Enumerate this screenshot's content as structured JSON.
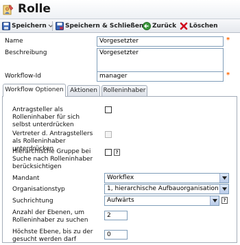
{
  "window": {
    "title": "Rolle"
  },
  "toolbar": {
    "save": "Speichern",
    "save_close": "Speichern & Schließen",
    "back": "Zurück",
    "delete": "Löschen"
  },
  "form": {
    "name_label": "Name",
    "name_value": "Vorgesetzter",
    "description_label": "Beschreibung",
    "description_value": "Vorgesetzter",
    "workflow_id_label": "Workflow-Id",
    "workflow_id_value": "manager",
    "required_marker": "*"
  },
  "tabs": [
    {
      "label": "Workflow Optionen",
      "active": true
    },
    {
      "label": "Aktionen",
      "active": false
    },
    {
      "label": "Rolleninhaber",
      "active": false
    }
  ],
  "options": {
    "suppress_applicant_label": "Antragsteller als Rolleninhaber für sich selbst unterdrücken",
    "suppress_substitute_label": "Vertreter d. Antragstellers als Rolleninhaber unterdrücken",
    "hier_group_label": "Hierarchische Gruppe bei Suche nach Rolleninhaber berücksichtigen",
    "help_glyph": "?",
    "mandant_label": "Mandant",
    "mandant_value": "Workflex",
    "orgtype_label": "Organisationstyp",
    "orgtype_value": "1, hierarchische Aufbauorganisation",
    "direction_label": "Suchrichtung",
    "direction_value": "Aufwärts",
    "levels_label": "Anzahl der Ebenen, um Rolleninhaber zu suchen",
    "levels_value": "2",
    "max_level_label": "Höchste Ebene, bis zu der gesucht werden darf",
    "max_level_value": "0"
  },
  "colors": {
    "accent": "#ff6600",
    "tab_border": "#a3acb8",
    "field_border": "#7f9db9"
  }
}
